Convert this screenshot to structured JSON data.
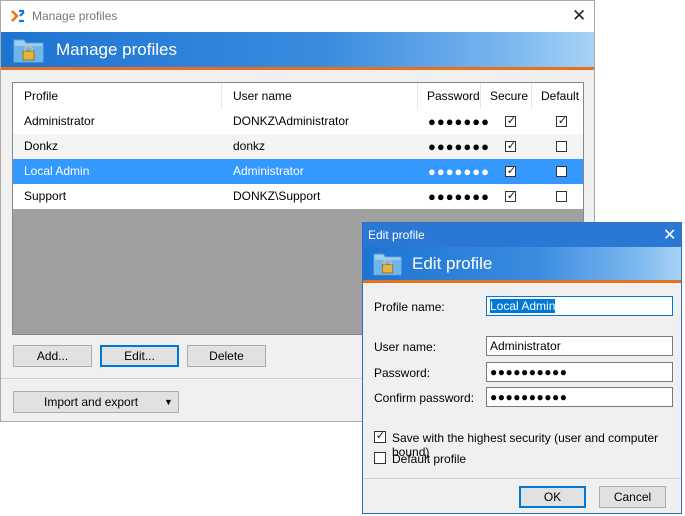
{
  "main_window": {
    "title": "Manage profiles",
    "banner_title": "Manage profiles",
    "columns": [
      "Profile",
      "User name",
      "Password",
      "Secure",
      "Default"
    ],
    "rows": [
      {
        "profile": "Administrator",
        "user": "DONKZ\\Administrator",
        "password": "●●●●●●●",
        "secure": true,
        "default": true,
        "selected": false
      },
      {
        "profile": "Donkz",
        "user": "donkz",
        "password": "●●●●●●●",
        "secure": true,
        "default": false,
        "selected": false
      },
      {
        "profile": "Local Admin",
        "user": "Administrator",
        "password": "●●●●●●●",
        "secure": true,
        "default": false,
        "selected": true
      },
      {
        "profile": "Support",
        "user": "DONKZ\\Support",
        "password": "●●●●●●●",
        "secure": true,
        "default": false,
        "selected": false
      }
    ],
    "buttons": {
      "add": "Add...",
      "edit": "Edit...",
      "delete": "Delete"
    },
    "import_export": "Import and export"
  },
  "edit_dialog": {
    "title": "Edit profile",
    "banner_title": "Edit profile",
    "profile_name_label": "Profile name:",
    "profile_name_value": "Local Admin",
    "user_name_label": "User name:",
    "user_name_value": "Administrator",
    "password_label": "Password:",
    "password_value": "●●●●●●●●●●",
    "confirm_label": "Confirm password:",
    "confirm_value": "●●●●●●●●●●",
    "secure_label": "Save with the highest security (user and computer bound)",
    "secure_checked": true,
    "default_label": "Default profile",
    "default_checked": false,
    "ok": "OK",
    "cancel": "Cancel"
  },
  "colors": {
    "accent": "#0078d7",
    "banner": "#2b7ad6",
    "orange": "#e8701c",
    "selection": "#3399ff"
  }
}
